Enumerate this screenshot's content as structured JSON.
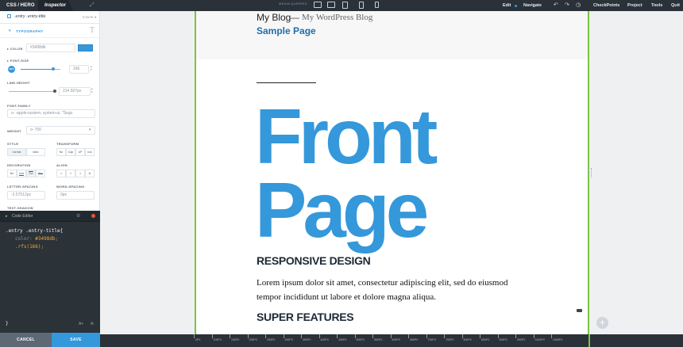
{
  "topbar": {
    "logo": "CSS / HERO",
    "inspector_tab": "Inspector",
    "media_queries_label": "MEDIA QUERIES:",
    "edit": "Edit",
    "navigate": "Navigate",
    "menus": [
      "CheckPoints",
      "Project",
      "Tools",
      "Quit"
    ]
  },
  "inspector": {
    "selector": ".entry .entry-title",
    "state": "STATE",
    "section": "TYPOGRAPHY",
    "color_label": "COLOR",
    "color_value": "#3498db",
    "font_size_label": "FONT-SIZE",
    "rfs_badge": "RFS",
    "font_size_value": "166",
    "font_size_slider": 0.82,
    "line_height_label": "LINE-HEIGHT",
    "line_height_value": "214.507px",
    "line_height_slider": 0.96,
    "font_family_label": "FONT-FAMILY",
    "font_family_value": "-apple-system, system-ui, \"Sego",
    "weight_label": "WEIGHT",
    "weight_value": "700",
    "style_label": "STYLE",
    "style_options": [
      "normal",
      "italic"
    ],
    "transform_label": "TRANSFORM",
    "transform_options": [
      "No",
      "Cap",
      "UP",
      "low"
    ],
    "decoration_label": "DECORATION",
    "decoration_options": [
      "No",
      "und",
      "Ovr",
      "Abc"
    ],
    "align_label": "ALIGN",
    "letter_spacing_label": "LETTER-SPACING",
    "letter_spacing_value": "-3.57512px",
    "word_spacing_label": "WORD-SPACING",
    "word_spacing_value": "0px",
    "text_shadow_label": "TEXT-SHADOW"
  },
  "code_editor": {
    "title": "Code Editor",
    "line1": ".entry .entry-title{",
    "line2_prop": "color: ",
    "line2_val": "#3498db",
    "line3_prop": ".rfs(",
    "line3_val": "166",
    "line3_end": ");",
    "closing": "}",
    "font_up": "A+",
    "font_down": "A-",
    "cancel": "CANCEL",
    "save": "SAVE"
  },
  "preview": {
    "site_title": "My Blog",
    "separator": "—",
    "site_description": "My WordPress Blog",
    "nav_link": "Sample Page",
    "entry_title_1": "Front",
    "entry_title_2": "Page",
    "heading_1": "RESPONSIVE DESIGN",
    "paragraph": "Lorem ipsum dolor sit amet, consectetur adipiscing elit, sed do eiusmod tempor incididunt ut labore et dolore magna aliqua.",
    "heading_2": "SUPER FEATURES",
    "add_button": "+"
  },
  "ruler": {
    "labels": [
      "0PX",
      "100PX",
      "150PX",
      "200PX",
      "250PX",
      "300PX",
      "350PX",
      "400PX",
      "450PX",
      "500PX",
      "550PX",
      "600PX",
      "650PX",
      "700PX",
      "750PX",
      "800PX",
      "850PX",
      "900PX",
      "950PX",
      "1000PX",
      "1050PX"
    ]
  },
  "colors": {
    "accent": "#3498db",
    "viewport_border": "#7dc242",
    "save_button": "#3498db",
    "cancel_button": "#5d6975"
  }
}
